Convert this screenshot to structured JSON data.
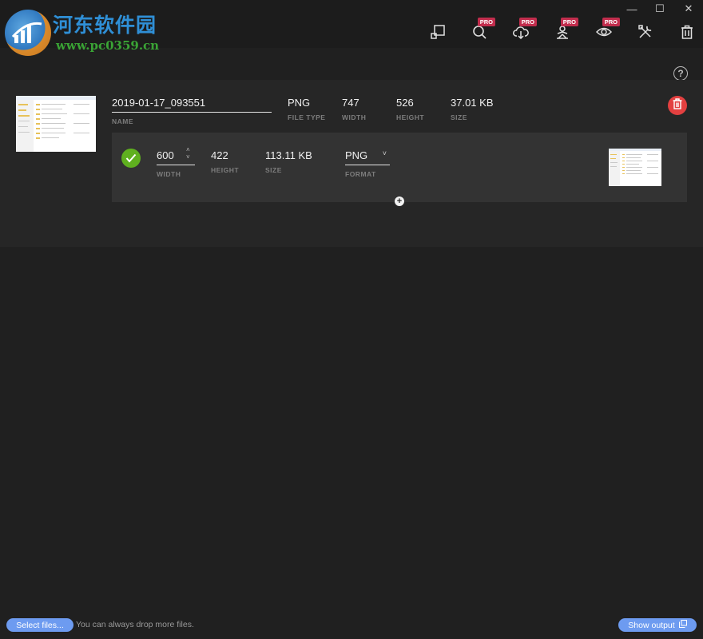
{
  "watermark": {
    "title": "河东软件园",
    "url": "www.pc0359.cn"
  },
  "window_controls": {
    "minimize": "—",
    "maximize": "☐",
    "close": "✕"
  },
  "toolbar": {
    "pro_badge": "PRO",
    "tools": [
      {
        "icon": "resize-icon",
        "pro": false
      },
      {
        "icon": "search-icon",
        "pro": true
      },
      {
        "icon": "cloud-download-icon",
        "pro": true
      },
      {
        "icon": "filter-icon",
        "pro": true
      },
      {
        "icon": "eye-icon",
        "pro": true
      },
      {
        "icon": "tools-icon",
        "pro": false
      },
      {
        "icon": "trash-icon",
        "pro": false
      }
    ]
  },
  "help": {
    "label": "?"
  },
  "file": {
    "name": "2019-01-17_093551",
    "name_label": "NAME",
    "file_type": "PNG",
    "file_type_label": "FILE TYPE",
    "width": "747",
    "width_label": "WIDTH",
    "height": "526",
    "height_label": "HEIGHT",
    "size": "37.01 KB",
    "size_label": "SIZE"
  },
  "output": {
    "status": "done",
    "width": "600",
    "width_label": "WIDTH",
    "stepper_up": "˄",
    "stepper_down": "˅",
    "height": "422",
    "height_label": "HEIGHT",
    "size": "113.11 KB",
    "size_label": "SIZE",
    "format": "PNG",
    "format_label": "FORMAT",
    "format_chevron": "˅"
  },
  "add_output": "+",
  "footer": {
    "select_files": "Select files...",
    "hint": "You can always drop more files.",
    "show_output": "Show output"
  },
  "colors": {
    "accent": "#6d9bf0",
    "success": "#5fb01f",
    "danger": "#e34040",
    "pro_badge": "#c22d4d"
  }
}
